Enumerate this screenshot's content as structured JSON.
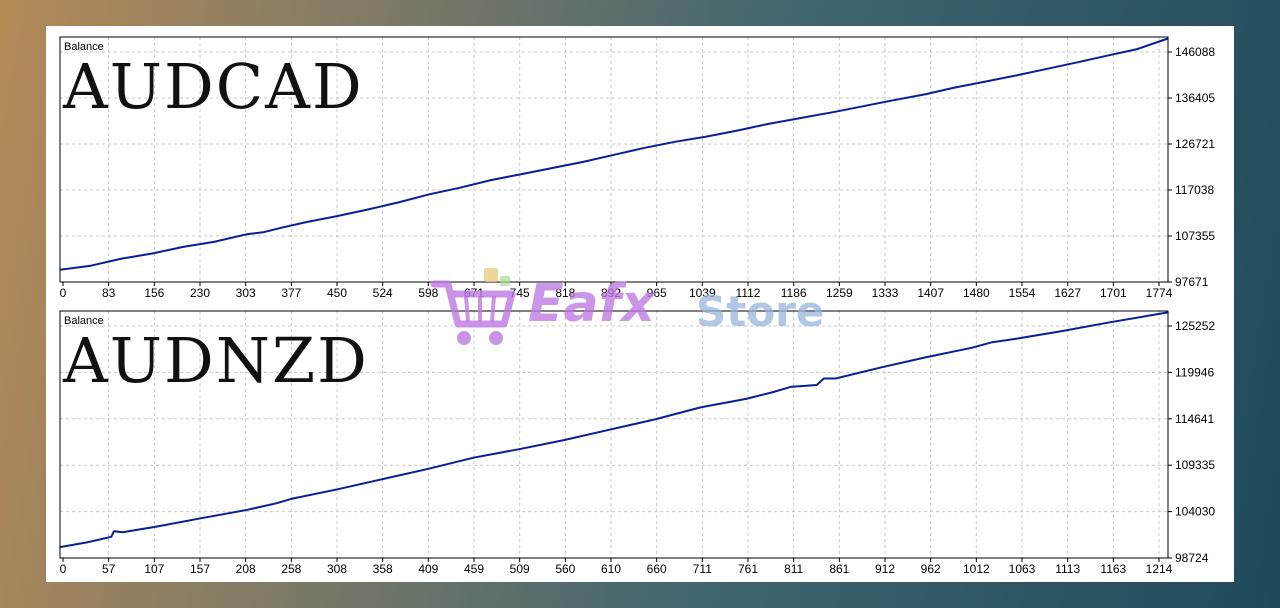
{
  "brand": {
    "name_part1": "Eafx",
    "name_part2": "Store",
    "icon": "shopping-cart-icon"
  },
  "colors": {
    "line": "#0a1e96",
    "grid": "#c8c8c8",
    "border": "#000000",
    "text": "#000000"
  },
  "chart_data": [
    {
      "type": "line",
      "label": "Balance",
      "title": "AUDCAD",
      "x_ticks": [
        "0",
        "83",
        "156",
        "230",
        "303",
        "377",
        "450",
        "524",
        "598",
        "671",
        "745",
        "818",
        "892",
        "965",
        "1039",
        "1112",
        "1186",
        "1259",
        "1333",
        "1407",
        "1480",
        "1554",
        "1627",
        "1701",
        "1774"
      ],
      "y_ticks": [
        "146088",
        "136405",
        "126721",
        "117038",
        "107355",
        "97671"
      ],
      "xlim": [
        0,
        1800
      ],
      "ylim": [
        97671,
        146088
      ],
      "grid": true,
      "series": [
        {
          "values": [
            [
              0,
              100100
            ],
            [
              50,
              100900
            ],
            [
              100,
              102300
            ],
            [
              150,
              103300
            ],
            [
              200,
              104600
            ],
            [
              250,
              105600
            ],
            [
              303,
              107100
            ],
            [
              330,
              107500
            ],
            [
              360,
              108400
            ],
            [
              400,
              109500
            ],
            [
              450,
              110700
            ],
            [
              500,
              112000
            ],
            [
              550,
              113400
            ],
            [
              600,
              115000
            ],
            [
              650,
              116300
            ],
            [
              700,
              117800
            ],
            [
              750,
              119000
            ],
            [
              800,
              120200
            ],
            [
              850,
              121400
            ],
            [
              900,
              122800
            ],
            [
              950,
              124200
            ],
            [
              1000,
              125400
            ],
            [
              1050,
              126400
            ],
            [
              1100,
              127600
            ],
            [
              1150,
              128900
            ],
            [
              1200,
              130000
            ],
            [
              1259,
              131300
            ],
            [
              1300,
              132300
            ],
            [
              1350,
              133500
            ],
            [
              1407,
              134800
            ],
            [
              1450,
              136000
            ],
            [
              1500,
              137200
            ],
            [
              1554,
              138500
            ],
            [
              1600,
              139700
            ],
            [
              1650,
              141000
            ],
            [
              1701,
              142400
            ],
            [
              1750,
              143700
            ],
            [
              1800,
              145800
            ]
          ]
        }
      ]
    },
    {
      "type": "line",
      "label": "Balance",
      "title": "AUDNZD",
      "x_ticks": [
        "0",
        "57",
        "107",
        "157",
        "208",
        "258",
        "308",
        "358",
        "409",
        "459",
        "509",
        "560",
        "610",
        "660",
        "711",
        "761",
        "811",
        "861",
        "912",
        "962",
        "1012",
        "1063",
        "1113",
        "1163",
        "1214"
      ],
      "y_ticks": [
        "125252",
        "119946",
        "114641",
        "109335",
        "104030",
        "98724"
      ],
      "xlim": [
        0,
        1230
      ],
      "ylim": [
        98724,
        125252
      ],
      "grid": true,
      "series": [
        {
          "values": [
            [
              0,
              99900
            ],
            [
              30,
              100400
            ],
            [
              57,
              101000
            ],
            [
              60,
              101600
            ],
            [
              70,
              101500
            ],
            [
              107,
              102100
            ],
            [
              157,
              103000
            ],
            [
              208,
              103900
            ],
            [
              240,
              104600
            ],
            [
              258,
              105100
            ],
            [
              308,
              106100
            ],
            [
              358,
              107200
            ],
            [
              409,
              108300
            ],
            [
              459,
              109500
            ],
            [
              509,
              110400
            ],
            [
              560,
              111400
            ],
            [
              610,
              112500
            ],
            [
              660,
              113600
            ],
            [
              711,
              114900
            ],
            [
              761,
              115800
            ],
            [
              790,
              116500
            ],
            [
              811,
              117100
            ],
            [
              840,
              117300
            ],
            [
              848,
              118000
            ],
            [
              861,
              118000
            ],
            [
              912,
              119200
            ],
            [
              962,
              120300
            ],
            [
              1012,
              121300
            ],
            [
              1035,
              121900
            ],
            [
              1063,
              122300
            ],
            [
              1113,
              123100
            ],
            [
              1163,
              124000
            ],
            [
              1230,
              125100
            ]
          ]
        }
      ]
    }
  ]
}
